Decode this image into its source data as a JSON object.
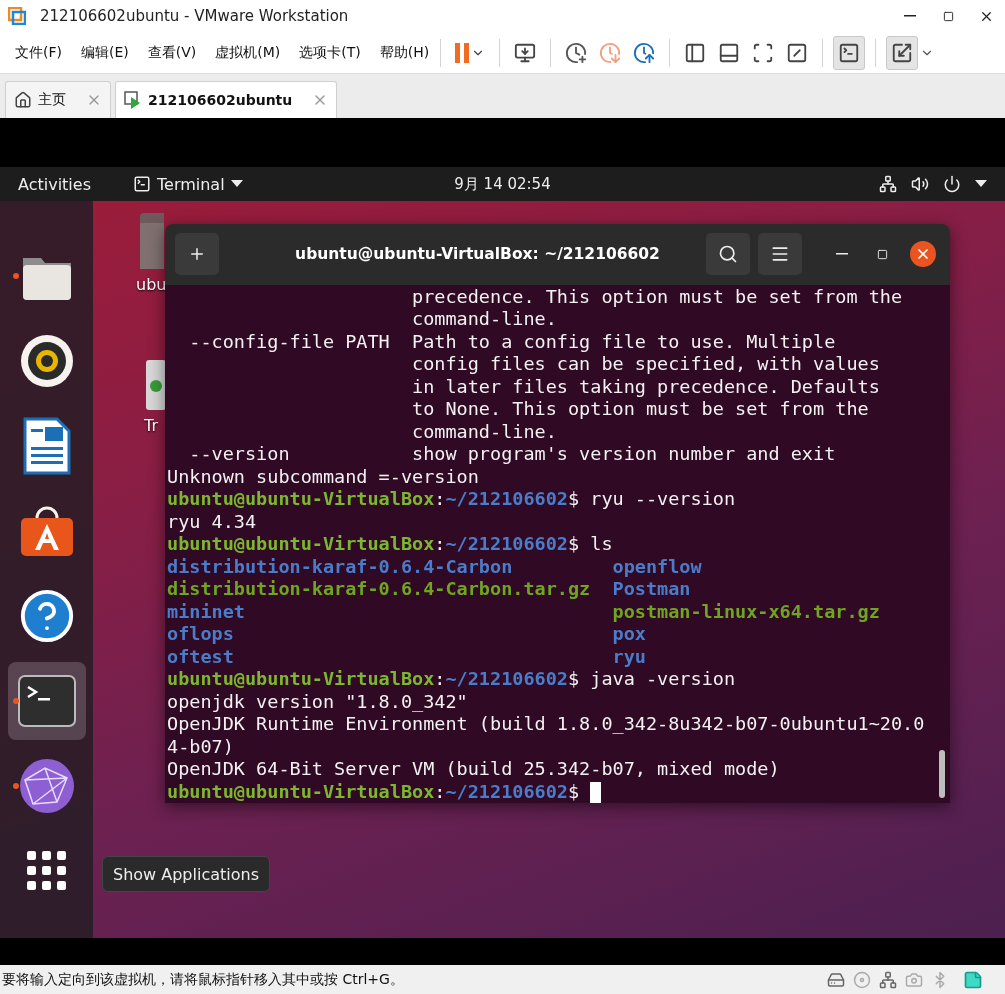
{
  "window": {
    "title": "212106602ubuntu - VMware Workstation"
  },
  "menu": [
    "文件(F)",
    "编辑(E)",
    "查看(V)",
    "虚拟机(M)",
    "选项卡(T)",
    "帮助(H)"
  ],
  "tabs": [
    {
      "label": "主页",
      "kind": "home",
      "selected": false
    },
    {
      "label": "212106602ubuntu",
      "kind": "vm",
      "selected": true
    }
  ],
  "guest": {
    "topbar": {
      "activities": "Activities",
      "app": "Terminal",
      "clock": "9月 14 02:54"
    },
    "dock": [
      {
        "kind": "files",
        "running": true,
        "selected": false
      },
      {
        "kind": "music",
        "running": false,
        "selected": false
      },
      {
        "kind": "writer",
        "running": false,
        "selected": false
      },
      {
        "kind": "software",
        "running": false,
        "selected": false
      },
      {
        "kind": "help",
        "running": false,
        "selected": false
      },
      {
        "kind": "terminal",
        "running": true,
        "selected": true
      },
      {
        "kind": "browser",
        "running": true,
        "selected": false
      }
    ],
    "tooltip": "Show Applications",
    "desktop_icons": [
      {
        "kind": "folder",
        "label": "ubu"
      },
      {
        "kind": "trash",
        "label": "Tr"
      }
    ],
    "terminal": {
      "title": "ubuntu@ubuntu-VirtualBox: ~/212106602",
      "lines": [
        {
          "kind": "text",
          "text": "                      precedence. This option must be set from the"
        },
        {
          "kind": "text",
          "text": "                      command-line."
        },
        {
          "kind": "text",
          "text": "  --config-file PATH  Path to a config file to use. Multiple"
        },
        {
          "kind": "text",
          "text": "                      config files can be specified, with values"
        },
        {
          "kind": "text",
          "text": "                      in later files taking precedence. Defaults"
        },
        {
          "kind": "text",
          "text": "                      to None. This option must be set from the"
        },
        {
          "kind": "text",
          "text": "                      command-line."
        },
        {
          "kind": "text",
          "text": "  --version           show program's version number and exit"
        },
        {
          "kind": "text",
          "text": "Unknown subcommand =-version"
        },
        {
          "kind": "prompt",
          "user": "ubuntu@ubuntu-VirtualBox",
          "sep": ":",
          "path": "~/212106602",
          "symbol": "$",
          "command": "ryu --version",
          "cursor": false
        },
        {
          "kind": "text",
          "text": "ryu 4.34"
        },
        {
          "kind": "prompt",
          "user": "ubuntu@ubuntu-VirtualBox",
          "sep": ":",
          "path": "~/212106602",
          "symbol": "$",
          "command": "ls",
          "cursor": false
        },
        {
          "kind": "listing",
          "items": [
            {
              "name": "distribution-karaf-0.6.4-Carbon",
              "color": "#4a7cc9"
            },
            {
              "name": "openflow",
              "color": "#4a7cc9"
            }
          ]
        },
        {
          "kind": "listing",
          "items": [
            {
              "name": "distribution-karaf-0.6.4-Carbon.tar.gz",
              "color": "#6fa521"
            },
            {
              "name": "Postman",
              "color": "#4a7cc9"
            }
          ]
        },
        {
          "kind": "listing",
          "items": [
            {
              "name": "mininet",
              "color": "#4a7cc9"
            },
            {
              "name": "postman-linux-x64.tar.gz",
              "color": "#6fa521"
            }
          ]
        },
        {
          "kind": "listing",
          "items": [
            {
              "name": "oflops",
              "color": "#4a7cc9"
            },
            {
              "name": "pox",
              "color": "#4a7cc9"
            }
          ]
        },
        {
          "kind": "listing",
          "items": [
            {
              "name": "oftest",
              "color": "#4a7cc9"
            },
            {
              "name": "ryu",
              "color": "#4a7cc9"
            }
          ]
        },
        {
          "kind": "prompt",
          "user": "ubuntu@ubuntu-VirtualBox",
          "sep": ":",
          "path": "~/212106602",
          "symbol": "$",
          "command": "java -version",
          "cursor": false
        },
        {
          "kind": "text",
          "text": "openjdk version \"1.8.0_342\""
        },
        {
          "kind": "text",
          "text": "OpenJDK Runtime Environment (build 1.8.0_342-8u342-b07-0ubuntu1~20.0"
        },
        {
          "kind": "text",
          "text": "4-b07)"
        },
        {
          "kind": "text",
          "text": "OpenJDK 64-Bit Server VM (build 25.342-b07, mixed mode)"
        },
        {
          "kind": "prompt",
          "user": "ubuntu@ubuntu-VirtualBox",
          "sep": ":",
          "path": "~/212106602",
          "symbol": "$",
          "cursor": true
        }
      ]
    }
  },
  "status_bar": {
    "message": "要将输入定向到该虚拟机，请将鼠标指针移入其中或按 Ctrl+G。"
  }
}
